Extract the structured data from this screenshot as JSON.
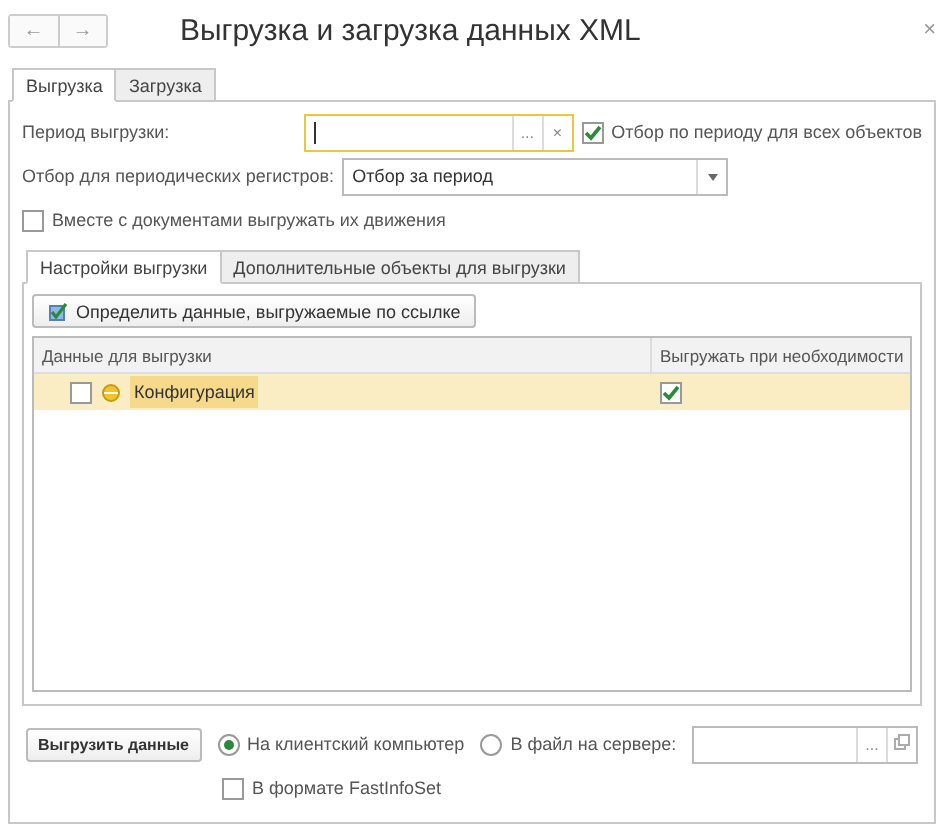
{
  "window": {
    "title": "Выгрузка и загрузка данных XML",
    "back": "←",
    "forward": "→",
    "close": "×"
  },
  "tabs": [
    {
      "label": "Выгрузка",
      "selected": true
    },
    {
      "label": "Загрузка",
      "selected": false
    }
  ],
  "period": {
    "label": "Период выгрузки:",
    "choose": "...",
    "clear": "×"
  },
  "filter_all": {
    "label": "Отбор по периоду для всех объектов",
    "checked": true
  },
  "registers": {
    "label": "Отбор для периодических регистров:",
    "value": "Отбор за период"
  },
  "with_movements": {
    "label": "Вместе с документами выгружать их движения",
    "checked": false
  },
  "inner_tabs": [
    {
      "label": "Настройки выгрузки",
      "selected": true
    },
    {
      "label": "Дополнительные объекты для выгрузки",
      "selected": false
    }
  ],
  "define_button": "Определить данные, выгружаемые по ссылке",
  "table": {
    "columns": [
      "Данные для выгрузки",
      "Выгружать при необходимости"
    ],
    "rows": [
      {
        "checked": false,
        "name": "Конфигурация",
        "export_if_needed": true,
        "selected": true
      }
    ]
  },
  "export_button": "Выгрузить данные",
  "targets": [
    {
      "label": "На клиентский компьютер",
      "selected": true
    },
    {
      "label": "В файл на сервере:",
      "selected": false
    }
  ],
  "server_file": {
    "choose": "..."
  },
  "fastinfoset": {
    "label": "В формате FastInfoSet",
    "checked": false
  }
}
